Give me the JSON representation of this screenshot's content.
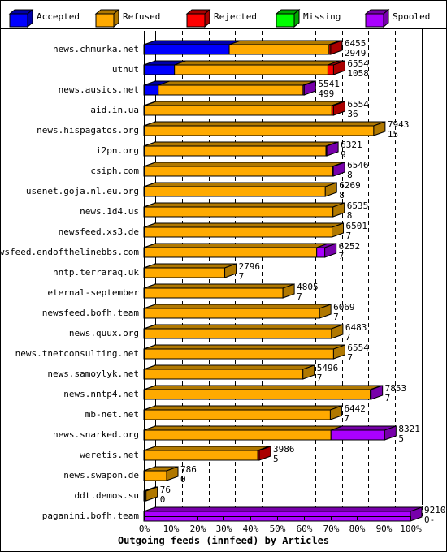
{
  "chart_data": {
    "type": "bar",
    "orientation": "horizontal",
    "stacked": true,
    "three_d": true,
    "xlabel": "Outgoing feeds (innfeed) by Articles",
    "xlim": [
      0,
      100
    ],
    "x_unit": "%",
    "x_ticks": [
      "0%",
      "10%",
      "20%",
      "30%",
      "40%",
      "50%",
      "60%",
      "70%",
      "80%",
      "90%",
      "100%"
    ],
    "grid": "vertical dashed",
    "legend_position": "top",
    "legend": [
      {
        "name": "Accepted",
        "color": "#0000ff",
        "dark": "#0000aa"
      },
      {
        "name": "Refused",
        "color": "#ffaa00",
        "dark": "#b07800"
      },
      {
        "name": "Rejected",
        "color": "#ff0000",
        "dark": "#aa0000"
      },
      {
        "name": "Missing",
        "color": "#00ff00",
        "dark": "#00aa00"
      },
      {
        "name": "Spooled",
        "color": "#aa00ff",
        "dark": "#7700aa"
      }
    ],
    "rows": [
      {
        "host": "news.chmurka.net",
        "total": "6455",
        "accepted": "2949",
        "segments": [
          2949,
          3450,
          56,
          0,
          0
        ]
      },
      {
        "host": "utnut",
        "total": "6554",
        "accepted": "1058",
        "segments": [
          1058,
          5300,
          196,
          0,
          0
        ]
      },
      {
        "host": "news.ausics.net",
        "total": "5541",
        "accepted": "499",
        "segments": [
          499,
          5002,
          0,
          0,
          40
        ]
      },
      {
        "host": "aid.in.ua",
        "total": "6554",
        "accepted": "36",
        "segments": [
          36,
          6460,
          58,
          0,
          0
        ]
      },
      {
        "host": "news.hispagatos.org",
        "total": "7943",
        "accepted": "15",
        "segments": [
          15,
          7928,
          0,
          0,
          0
        ]
      },
      {
        "host": "i2pn.org",
        "total": "6321",
        "accepted": "9",
        "segments": [
          9,
          6282,
          0,
          0,
          30
        ]
      },
      {
        "host": "csiph.com",
        "total": "6546",
        "accepted": "8",
        "segments": [
          8,
          6508,
          0,
          0,
          30
        ]
      },
      {
        "host": "usenet.goja.nl.eu.org",
        "total": "6269",
        "accepted": "8",
        "segments": [
          8,
          6261,
          0,
          0,
          0
        ]
      },
      {
        "host": "news.1d4.us",
        "total": "6535",
        "accepted": "8",
        "segments": [
          8,
          6527,
          0,
          0,
          0
        ]
      },
      {
        "host": "newsfeed.xs3.de",
        "total": "6501",
        "accepted": "7",
        "segments": [
          7,
          6494,
          0,
          0,
          0
        ]
      },
      {
        "host": "newsfeed.endofthelinebbs.com",
        "total": "6252",
        "accepted": "7",
        "segments": [
          7,
          5965,
          0,
          0,
          280
        ]
      },
      {
        "host": "nntp.terraraq.uk",
        "total": "2796",
        "accepted": "7",
        "segments": [
          7,
          2789,
          0,
          0,
          0
        ]
      },
      {
        "host": "eternal-september",
        "total": "4805",
        "accepted": "7",
        "segments": [
          7,
          4798,
          0,
          0,
          0
        ]
      },
      {
        "host": "newsfeed.bofh.team",
        "total": "6069",
        "accepted": "7",
        "segments": [
          7,
          6062,
          0,
          0,
          0
        ]
      },
      {
        "host": "news.quux.org",
        "total": "6483",
        "accepted": "7",
        "segments": [
          7,
          6476,
          0,
          0,
          0
        ]
      },
      {
        "host": "news.tnetconsulting.net",
        "total": "6554",
        "accepted": "7",
        "segments": [
          7,
          6547,
          0,
          0,
          0
        ]
      },
      {
        "host": "news.samoylyk.net",
        "total": "5496",
        "accepted": "7",
        "segments": [
          7,
          5489,
          0,
          0,
          0
        ]
      },
      {
        "host": "news.nntp4.net",
        "total": "7853",
        "accepted": "7",
        "segments": [
          7,
          7816,
          0,
          0,
          30
        ]
      },
      {
        "host": "mb-net.net",
        "total": "6442",
        "accepted": "7",
        "segments": [
          7,
          6435,
          0,
          0,
          0
        ]
      },
      {
        "host": "news.snarked.org",
        "total": "8321",
        "accepted": "5",
        "segments": [
          5,
          6460,
          0,
          0,
          1856
        ]
      },
      {
        "host": "weretis.net",
        "total": "3986",
        "accepted": "5",
        "segments": [
          5,
          3931,
          50,
          0,
          0
        ]
      },
      {
        "host": "news.swapon.de",
        "total": "786",
        "accepted": "0",
        "segments": [
          0,
          786,
          0,
          0,
          0
        ]
      },
      {
        "host": "ddt.demos.su",
        "total": "76",
        "accepted": "0",
        "segments": [
          0,
          76,
          0,
          0,
          0
        ]
      },
      {
        "host": "paganini.bofh.team",
        "total": "9210",
        "accepted": "0-",
        "segments": [
          0,
          0,
          0,
          0,
          9210
        ]
      }
    ]
  }
}
